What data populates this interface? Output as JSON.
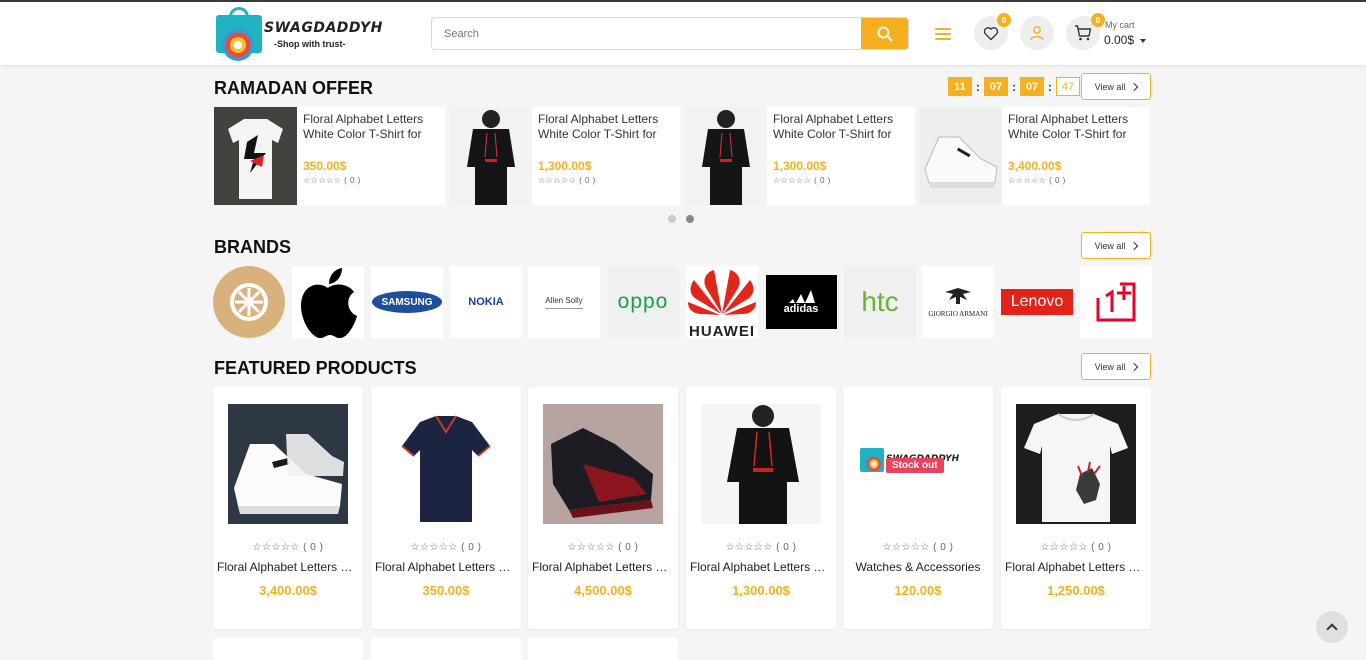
{
  "header": {
    "logo_title": "SWAGDADDYH",
    "logo_tagline": "-Shop with trust-",
    "search_placeholder": "Search",
    "wishlist_count": "0",
    "cart_count": "0",
    "cart_label": "My cart",
    "cart_total": "0.00$"
  },
  "ramadan": {
    "title": "RAMADAN OFFER",
    "timer": [
      "11",
      "07",
      "07",
      "47"
    ],
    "view_all": "View all",
    "products": [
      {
        "name": "Floral Alphabet Letters White Color T-Shirt for",
        "price": "350.00$",
        "rating": "☆☆☆☆☆ ( 0 )"
      },
      {
        "name": "Floral Alphabet Letters White Color T-Shirt for",
        "price": "1,300.00$",
        "rating": "☆☆☆☆☆ ( 0 )"
      },
      {
        "name": "Floral Alphabet Letters White Color T-Shirt for",
        "price": "1,300.00$",
        "rating": "☆☆☆☆☆ ( 0 )"
      },
      {
        "name": "Floral Alphabet Letters White Color T-Shirt for",
        "price": "3,400.00$",
        "rating": "☆☆☆☆☆ ( 0 )"
      }
    ]
  },
  "brands": {
    "title": "BRANDS",
    "view_all": "View all",
    "items": [
      "SAMSUNG",
      "NOKIA",
      "Allen Solly",
      "oppo",
      "HUAWEI",
      "adidas",
      "htc",
      "GIORGIO ARMANI",
      "Lenovo",
      "1+"
    ]
  },
  "featured": {
    "title": "FEATURED PRODUCTS",
    "view_all": "View all",
    "stock_out": "Stock out",
    "products": [
      {
        "name": "Floral Alphabet Letters W...",
        "price": "3,400.00$",
        "rating": "☆☆☆☆☆ ( 0 )"
      },
      {
        "name": "Floral Alphabet Letters W...",
        "price": "350.00$",
        "rating": "☆☆☆☆☆ ( 0 )"
      },
      {
        "name": "Floral Alphabet Letters W...",
        "price": "4,500.00$",
        "rating": "☆☆☆☆☆ ( 0 )"
      },
      {
        "name": "Floral Alphabet Letters W...",
        "price": "1,300.00$",
        "rating": "☆☆☆☆☆ ( 0 )"
      },
      {
        "name": "Watches & Accessories",
        "price": "120.00$",
        "rating": "☆☆☆☆☆ ( 0 )"
      },
      {
        "name": "Floral Alphabet Letters W...",
        "price": "1,250.00$",
        "rating": "☆☆☆☆☆ ( 0 )"
      }
    ]
  },
  "colors": {
    "accent": "#f4b01f",
    "stockout": "#e8435a"
  },
  "icons": [
    "search-icon",
    "menu-icon",
    "heart-icon",
    "user-icon",
    "cart-icon",
    "chevron-right-icon",
    "chevron-up-icon"
  ]
}
